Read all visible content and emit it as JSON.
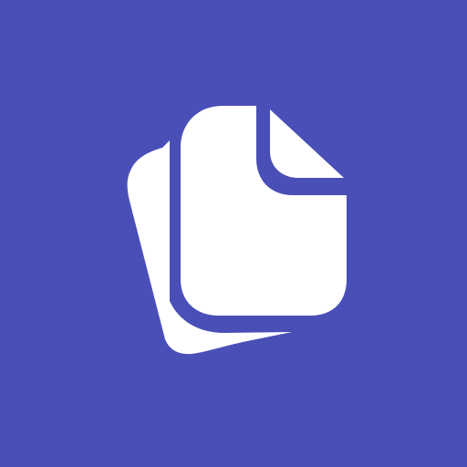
{
  "icon": {
    "name": "documents-icon",
    "background_color": "#4a4fb8",
    "foreground_color": "#ffffff"
  }
}
